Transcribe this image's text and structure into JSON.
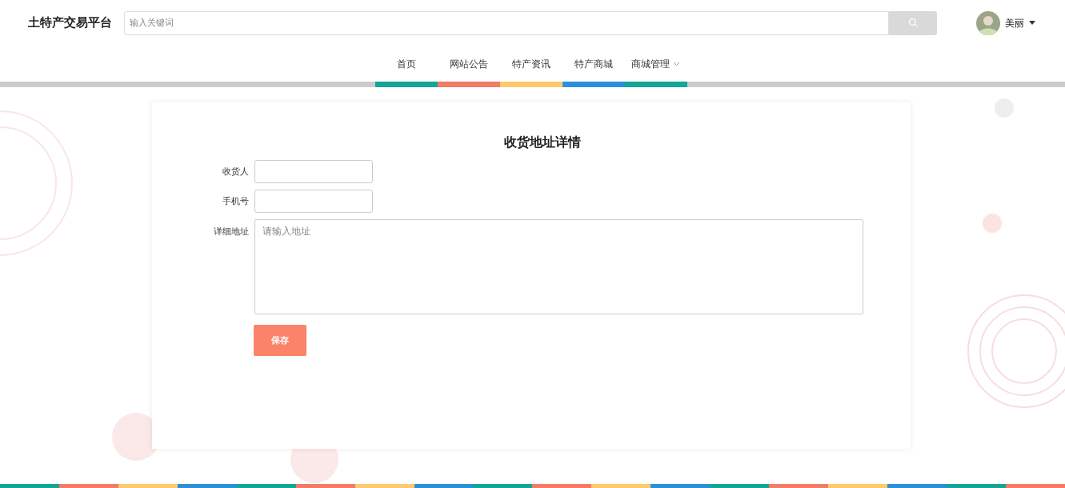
{
  "header": {
    "logo": "土特产交易平台",
    "search": {
      "placeholder": "输入关键词"
    },
    "user": {
      "name": "美丽"
    }
  },
  "nav": [
    {
      "label": "首页",
      "color": "#14a596",
      "dropdown": false
    },
    {
      "label": "网站公告",
      "color": "#f27c66",
      "dropdown": false
    },
    {
      "label": "特产资讯",
      "color": "#fdcb6e",
      "dropdown": false
    },
    {
      "label": "特产商城",
      "color": "#2d8fdc",
      "dropdown": false
    },
    {
      "label": "商城管理",
      "color": "#14a596",
      "dropdown": true
    }
  ],
  "form": {
    "title": "收货地址详情",
    "fields": [
      {
        "kind": "input",
        "label": "收货人"
      },
      {
        "kind": "input",
        "label": "手机号"
      },
      {
        "kind": "textarea",
        "label": "详细地址",
        "placeholder": "请输入地址"
      }
    ],
    "submit": "保存"
  }
}
